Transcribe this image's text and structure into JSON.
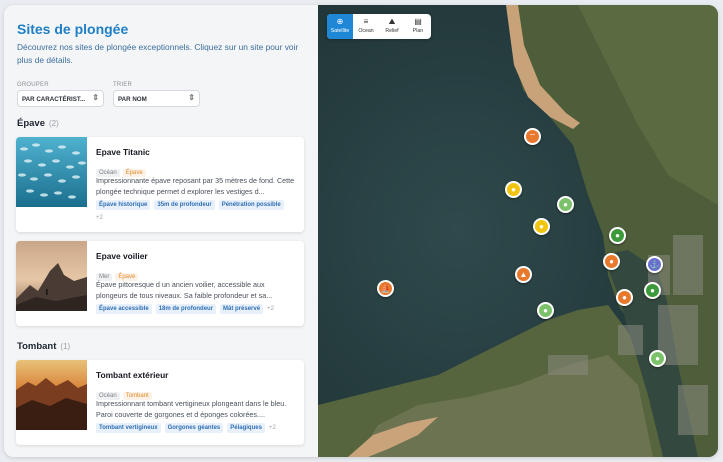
{
  "panel": {
    "title": "Sites de plongée",
    "description": "Découvrez nos sites de plongée exceptionnels. Cliquez sur un site pour voir plus de détails.",
    "group_by": {
      "label": "GROUPER",
      "value": "PAR CARACTÉRIST..."
    },
    "sort_by": {
      "label": "TRIER",
      "value": "PAR NOM"
    }
  },
  "groups": [
    {
      "name": "Épave",
      "count": "(2)"
    },
    {
      "name": "Tombant",
      "count": "(1)"
    }
  ],
  "sites": [
    {
      "name": "Epave Titanic",
      "tags": [
        "Océan",
        "Épave"
      ],
      "description": "Impressionnante épave reposant par 35 mètres de fond. Cette plongée technique permet d explorer les vestiges d...",
      "chips": [
        "Épave historique",
        "35m de profondeur",
        "Pénétration possible"
      ],
      "more": "+2"
    },
    {
      "name": "Epave voilier",
      "tags": [
        "Mer",
        "Épave"
      ],
      "description": "Épave pittoresque d un ancien voilier, accessible aux plongeurs de tous niveaux. Sa faible profondeur et sa...",
      "chips": [
        "Épave accessible",
        "18m de profondeur",
        "Mât préservé"
      ],
      "more": "+2"
    },
    {
      "name": "Tombant extérieur",
      "tags": [
        "Océan",
        "Tombant"
      ],
      "description": "Impressionnant tombant vertigineux plongeant dans le bleu. Paroi couverte de gorgones et d éponges colorées....",
      "chips": [
        "Tombant vertigineux",
        "Gorgones géantes",
        "Pélagiques"
      ],
      "more": "+2"
    }
  ],
  "map": {
    "layers": [
      {
        "label": "Satellite",
        "icon": "globe-icon",
        "active": true
      },
      {
        "label": "Ocean",
        "icon": "waves-icon",
        "active": false
      },
      {
        "label": "Relief",
        "icon": "mountain-icon",
        "active": false
      },
      {
        "label": "Plan",
        "icon": "map-icon",
        "active": false
      }
    ],
    "marker_colors": {
      "orange": "#e8782b",
      "yellow": "#f1c40f",
      "green": "#7cc26b",
      "dark_green": "#3d9a3a",
      "purple": "#6a6fcf"
    }
  }
}
